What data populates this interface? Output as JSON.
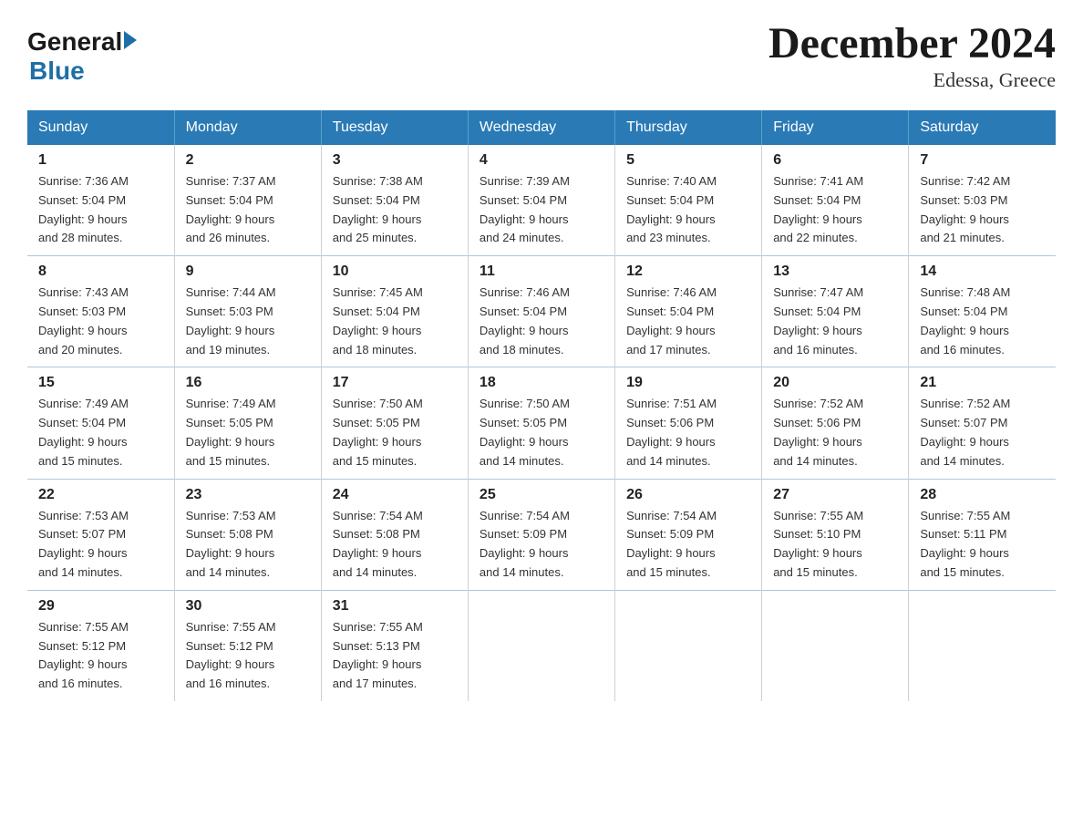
{
  "logo": {
    "general": "General",
    "blue": "Blue"
  },
  "title": "December 2024",
  "subtitle": "Edessa, Greece",
  "days_of_week": [
    "Sunday",
    "Monday",
    "Tuesday",
    "Wednesday",
    "Thursday",
    "Friday",
    "Saturday"
  ],
  "weeks": [
    [
      {
        "day": "1",
        "sunrise": "7:36 AM",
        "sunset": "5:04 PM",
        "daylight": "9 hours and 28 minutes."
      },
      {
        "day": "2",
        "sunrise": "7:37 AM",
        "sunset": "5:04 PM",
        "daylight": "9 hours and 26 minutes."
      },
      {
        "day": "3",
        "sunrise": "7:38 AM",
        "sunset": "5:04 PM",
        "daylight": "9 hours and 25 minutes."
      },
      {
        "day": "4",
        "sunrise": "7:39 AM",
        "sunset": "5:04 PM",
        "daylight": "9 hours and 24 minutes."
      },
      {
        "day": "5",
        "sunrise": "7:40 AM",
        "sunset": "5:04 PM",
        "daylight": "9 hours and 23 minutes."
      },
      {
        "day": "6",
        "sunrise": "7:41 AM",
        "sunset": "5:04 PM",
        "daylight": "9 hours and 22 minutes."
      },
      {
        "day": "7",
        "sunrise": "7:42 AM",
        "sunset": "5:03 PM",
        "daylight": "9 hours and 21 minutes."
      }
    ],
    [
      {
        "day": "8",
        "sunrise": "7:43 AM",
        "sunset": "5:03 PM",
        "daylight": "9 hours and 20 minutes."
      },
      {
        "day": "9",
        "sunrise": "7:44 AM",
        "sunset": "5:03 PM",
        "daylight": "9 hours and 19 minutes."
      },
      {
        "day": "10",
        "sunrise": "7:45 AM",
        "sunset": "5:04 PM",
        "daylight": "9 hours and 18 minutes."
      },
      {
        "day": "11",
        "sunrise": "7:46 AM",
        "sunset": "5:04 PM",
        "daylight": "9 hours and 18 minutes."
      },
      {
        "day": "12",
        "sunrise": "7:46 AM",
        "sunset": "5:04 PM",
        "daylight": "9 hours and 17 minutes."
      },
      {
        "day": "13",
        "sunrise": "7:47 AM",
        "sunset": "5:04 PM",
        "daylight": "9 hours and 16 minutes."
      },
      {
        "day": "14",
        "sunrise": "7:48 AM",
        "sunset": "5:04 PM",
        "daylight": "9 hours and 16 minutes."
      }
    ],
    [
      {
        "day": "15",
        "sunrise": "7:49 AM",
        "sunset": "5:04 PM",
        "daylight": "9 hours and 15 minutes."
      },
      {
        "day": "16",
        "sunrise": "7:49 AM",
        "sunset": "5:05 PM",
        "daylight": "9 hours and 15 minutes."
      },
      {
        "day": "17",
        "sunrise": "7:50 AM",
        "sunset": "5:05 PM",
        "daylight": "9 hours and 15 minutes."
      },
      {
        "day": "18",
        "sunrise": "7:50 AM",
        "sunset": "5:05 PM",
        "daylight": "9 hours and 14 minutes."
      },
      {
        "day": "19",
        "sunrise": "7:51 AM",
        "sunset": "5:06 PM",
        "daylight": "9 hours and 14 minutes."
      },
      {
        "day": "20",
        "sunrise": "7:52 AM",
        "sunset": "5:06 PM",
        "daylight": "9 hours and 14 minutes."
      },
      {
        "day": "21",
        "sunrise": "7:52 AM",
        "sunset": "5:07 PM",
        "daylight": "9 hours and 14 minutes."
      }
    ],
    [
      {
        "day": "22",
        "sunrise": "7:53 AM",
        "sunset": "5:07 PM",
        "daylight": "9 hours and 14 minutes."
      },
      {
        "day": "23",
        "sunrise": "7:53 AM",
        "sunset": "5:08 PM",
        "daylight": "9 hours and 14 minutes."
      },
      {
        "day": "24",
        "sunrise": "7:54 AM",
        "sunset": "5:08 PM",
        "daylight": "9 hours and 14 minutes."
      },
      {
        "day": "25",
        "sunrise": "7:54 AM",
        "sunset": "5:09 PM",
        "daylight": "9 hours and 14 minutes."
      },
      {
        "day": "26",
        "sunrise": "7:54 AM",
        "sunset": "5:09 PM",
        "daylight": "9 hours and 15 minutes."
      },
      {
        "day": "27",
        "sunrise": "7:55 AM",
        "sunset": "5:10 PM",
        "daylight": "9 hours and 15 minutes."
      },
      {
        "day": "28",
        "sunrise": "7:55 AM",
        "sunset": "5:11 PM",
        "daylight": "9 hours and 15 minutes."
      }
    ],
    [
      {
        "day": "29",
        "sunrise": "7:55 AM",
        "sunset": "5:12 PM",
        "daylight": "9 hours and 16 minutes."
      },
      {
        "day": "30",
        "sunrise": "7:55 AM",
        "sunset": "5:12 PM",
        "daylight": "9 hours and 16 minutes."
      },
      {
        "day": "31",
        "sunrise": "7:55 AM",
        "sunset": "5:13 PM",
        "daylight": "9 hours and 17 minutes."
      },
      null,
      null,
      null,
      null
    ]
  ],
  "labels": {
    "sunrise": "Sunrise:",
    "sunset": "Sunset:",
    "daylight": "Daylight:"
  }
}
